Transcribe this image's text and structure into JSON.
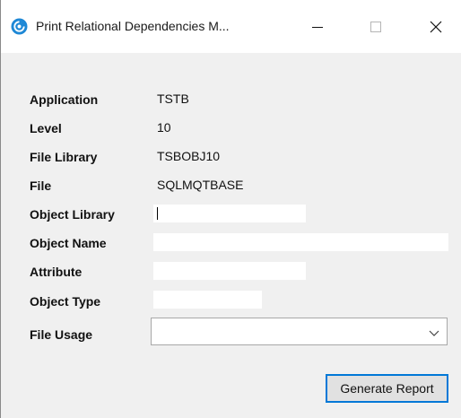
{
  "window": {
    "title": "Print Relational Dependencies M...",
    "icon": "app-swirl-icon",
    "controls": [
      "minimize-icon",
      "maximize-icon",
      "close-icon"
    ],
    "accent_color": "#0078d7"
  },
  "form": {
    "application": {
      "label": "Application",
      "value": "TSTB"
    },
    "level": {
      "label": "Level",
      "value": "10"
    },
    "file_library": {
      "label": "File Library",
      "value": "TSBOBJ10"
    },
    "file": {
      "label": "File",
      "value": "SQLMQTBASE"
    },
    "object_library": {
      "label": "Object Library",
      "value": ""
    },
    "object_name": {
      "label": "Object Name",
      "value": ""
    },
    "attribute": {
      "label": "Attribute",
      "value": ""
    },
    "object_type": {
      "label": "Object Type",
      "value": ""
    },
    "file_usage": {
      "label": "File Usage",
      "selected": ""
    }
  },
  "actions": {
    "generate_label": "Generate Report"
  }
}
